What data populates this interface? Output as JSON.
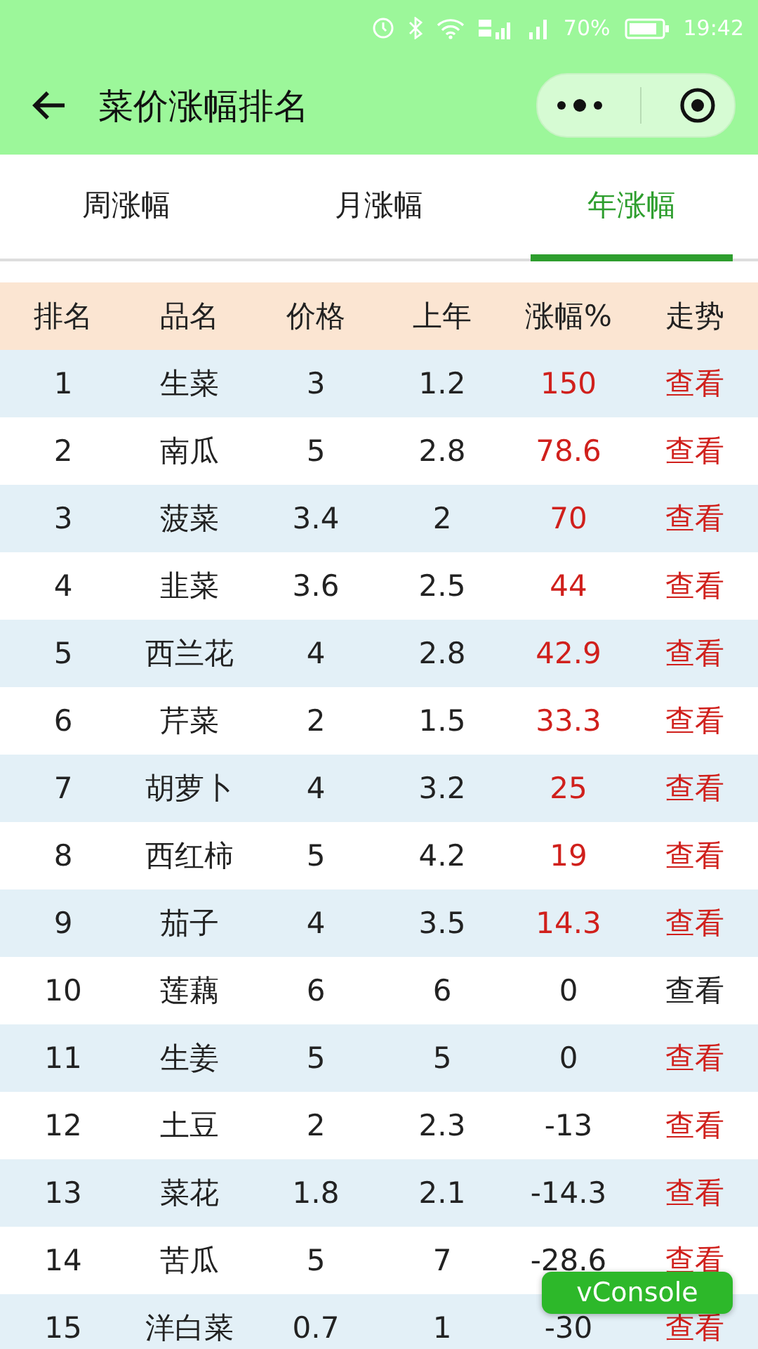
{
  "status_bar": {
    "battery_text": "70%",
    "time": "19:42"
  },
  "header": {
    "title": "菜价涨幅排名"
  },
  "tabs": [
    {
      "label": "周涨幅",
      "selected": false
    },
    {
      "label": "月涨幅",
      "selected": false
    },
    {
      "label": "年涨幅",
      "selected": true
    }
  ],
  "table": {
    "columns": [
      "排名",
      "品名",
      "价格",
      "上年",
      "涨幅%",
      "走势"
    ],
    "rows": [
      {
        "rank": "1",
        "name": "生菜",
        "price": "3",
        "last_year": "1.2",
        "change": "150",
        "rising": true,
        "link": "查看",
        "link_highlighted": true
      },
      {
        "rank": "2",
        "name": "南瓜",
        "price": "5",
        "last_year": "2.8",
        "change": "78.6",
        "rising": true,
        "link": "查看",
        "link_highlighted": true
      },
      {
        "rank": "3",
        "name": "菠菜",
        "price": "3.4",
        "last_year": "2",
        "change": "70",
        "rising": true,
        "link": "查看",
        "link_highlighted": true
      },
      {
        "rank": "4",
        "name": "韭菜",
        "price": "3.6",
        "last_year": "2.5",
        "change": "44",
        "rising": true,
        "link": "查看",
        "link_highlighted": true
      },
      {
        "rank": "5",
        "name": "西兰花",
        "price": "4",
        "last_year": "2.8",
        "change": "42.9",
        "rising": true,
        "link": "查看",
        "link_highlighted": true
      },
      {
        "rank": "6",
        "name": "芹菜",
        "price": "2",
        "last_year": "1.5",
        "change": "33.3",
        "rising": true,
        "link": "查看",
        "link_highlighted": true
      },
      {
        "rank": "7",
        "name": "胡萝卜",
        "price": "4",
        "last_year": "3.2",
        "change": "25",
        "rising": true,
        "link": "查看",
        "link_highlighted": true
      },
      {
        "rank": "8",
        "name": "西红柿",
        "price": "5",
        "last_year": "4.2",
        "change": "19",
        "rising": true,
        "link": "查看",
        "link_highlighted": true
      },
      {
        "rank": "9",
        "name": "茄子",
        "price": "4",
        "last_year": "3.5",
        "change": "14.3",
        "rising": true,
        "link": "查看",
        "link_highlighted": true
      },
      {
        "rank": "10",
        "name": "莲藕",
        "price": "6",
        "last_year": "6",
        "change": "0",
        "rising": false,
        "link": "查看",
        "link_highlighted": false
      },
      {
        "rank": "11",
        "name": "生姜",
        "price": "5",
        "last_year": "5",
        "change": "0",
        "rising": false,
        "link": "查看",
        "link_highlighted": true
      },
      {
        "rank": "12",
        "name": "土豆",
        "price": "2",
        "last_year": "2.3",
        "change": "-13",
        "rising": false,
        "link": "查看",
        "link_highlighted": true
      },
      {
        "rank": "13",
        "name": "菜花",
        "price": "1.8",
        "last_year": "2.1",
        "change": "-14.3",
        "rising": false,
        "link": "查看",
        "link_highlighted": true
      },
      {
        "rank": "14",
        "name": "苦瓜",
        "price": "5",
        "last_year": "7",
        "change": "-28.6",
        "rising": false,
        "link": "查看",
        "link_highlighted": true
      },
      {
        "rank": "15",
        "name": "洋白菜",
        "price": "0.7",
        "last_year": "1",
        "change": "-30",
        "rising": false,
        "link": "查看",
        "link_highlighted": true
      }
    ]
  },
  "console_button": {
    "label": "vConsole"
  }
}
